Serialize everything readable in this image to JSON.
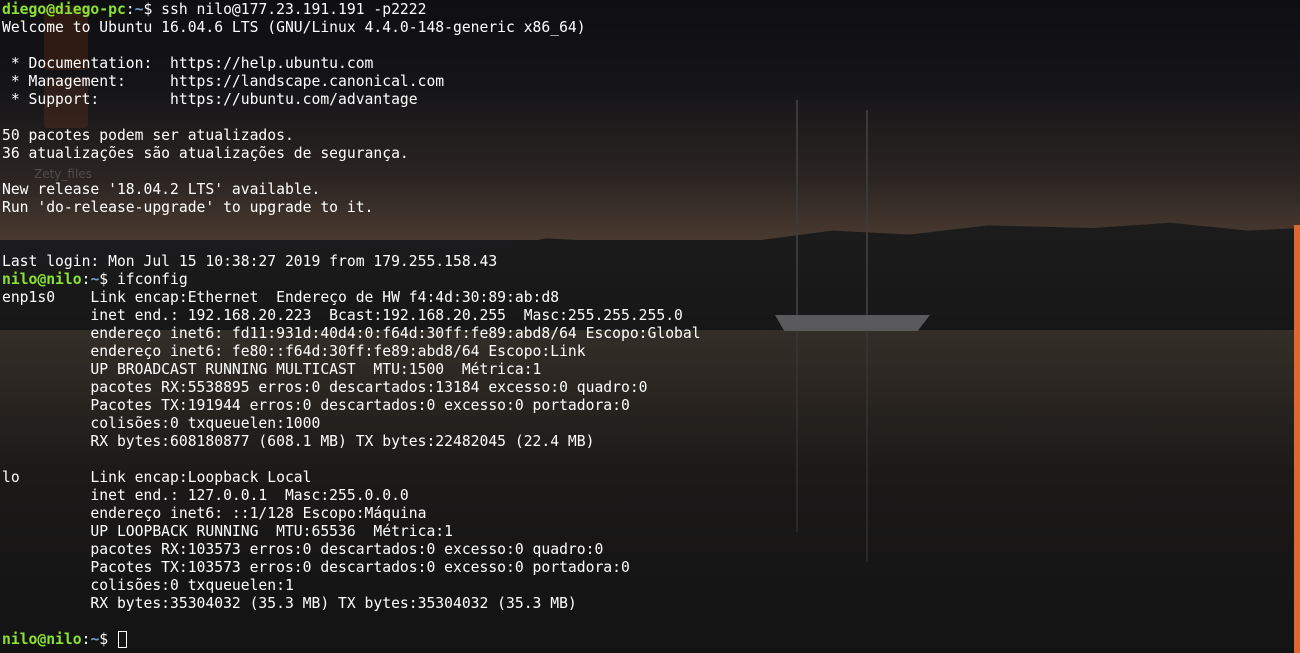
{
  "session": {
    "ssh_prompt_user": "diego@diego-pc",
    "ssh_prompt_path": "~",
    "ssh_command": "ssh nilo@177.23.191.191 -p2222",
    "remote_prompt_user": "nilo@nilo",
    "remote_prompt_path": "~",
    "ifconfig_command": "ifconfig"
  },
  "motd": [
    "Welcome to Ubuntu 16.04.6 LTS (GNU/Linux 4.4.0-148-generic x86_64)",
    "",
    " * Documentation:  https://help.ubuntu.com",
    " * Management:     https://landscape.canonical.com",
    " * Support:        https://ubuntu.com/advantage",
    "",
    "50 pacotes podem ser atualizados.",
    "36 atualizações são atualizações de segurança.",
    "",
    "New release '18.04.2 LTS' available.",
    "Run 'do-release-upgrade' to upgrade to it.",
    "",
    "",
    "Last login: Mon Jul 15 10:38:27 2019 from 179.255.158.43"
  ],
  "ifconfig_output": [
    "enp1s0    Link encap:Ethernet  Endereço de HW f4:4d:30:89:ab:d8",
    "          inet end.: 192.168.20.223  Bcast:192.168.20.255  Masc:255.255.255.0",
    "          endereço inet6: fd11:931d:40d4:0:f64d:30ff:fe89:abd8/64 Escopo:Global",
    "          endereço inet6: fe80::f64d:30ff:fe89:abd8/64 Escopo:Link",
    "          UP BROADCAST RUNNING MULTICAST  MTU:1500  Métrica:1",
    "          pacotes RX:5538895 erros:0 descartados:13184 excesso:0 quadro:0",
    "          Pacotes TX:191944 erros:0 descartados:0 excesso:0 portadora:0",
    "          colisões:0 txqueuelen:1000",
    "          RX bytes:608180877 (608.1 MB) TX bytes:22482045 (22.4 MB)",
    "",
    "lo        Link encap:Loopback Local",
    "          inet end.: 127.0.0.1  Masc:255.0.0.0",
    "          endereço inet6: ::1/128 Escopo:Máquina",
    "          UP LOOPBACK RUNNING  MTU:65536  Métrica:1",
    "          pacotes RX:103573 erros:0 descartados:0 excesso:0 quadro:0",
    "          Pacotes TX:103573 erros:0 descartados:0 excesso:0 portadora:0",
    "          colisões:0 txqueuelen:1",
    "          RX bytes:35304032 (35.3 MB) TX bytes:35304032 (35.3 MB)",
    ""
  ],
  "background": {
    "desktop_label": "Zety_files"
  },
  "colors": {
    "prompt_user": "#8ae234",
    "prompt_path": "#729fcf",
    "text": "#ffffff",
    "accent_strip": "#e0672e"
  }
}
